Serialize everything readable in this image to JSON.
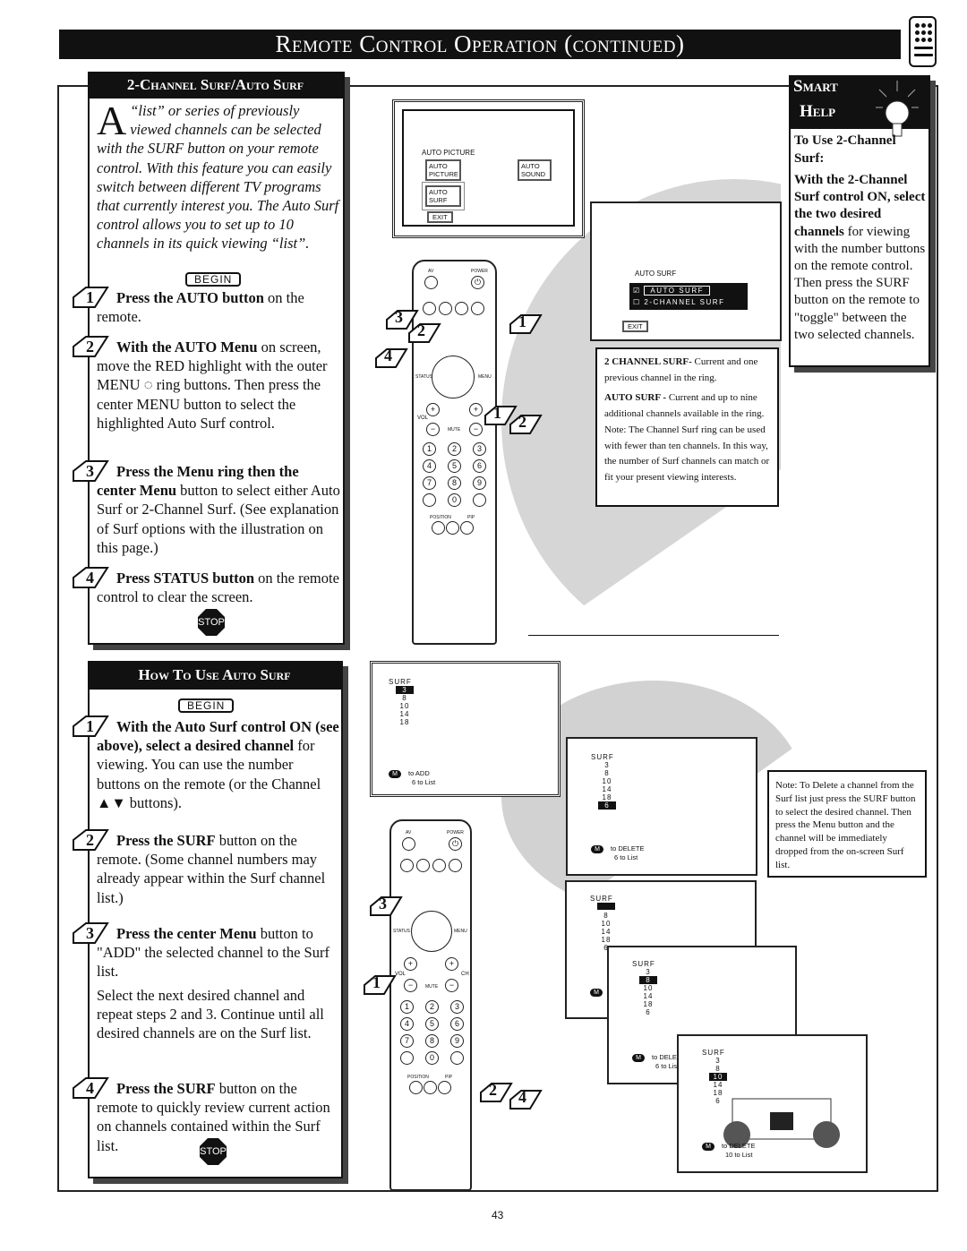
{
  "header": {
    "title": "Remote Control Operation (continued)",
    "icon": "remote-control-icon"
  },
  "section1": {
    "title": "2-Channel Surf/Auto Surf",
    "intro_drop_cap": "A",
    "intro": "“list” or series of previously viewed channels can be selected with the SURF button on your remote control. With this feature you can easily switch between different TV programs that currently interest you. The Auto Surf control allows you to set up to 10 channels in its quick viewing “list”.",
    "begin": "BEGIN",
    "steps": [
      {
        "num": "1",
        "bold": "Press the AUTO button",
        "text": " on the remote."
      },
      {
        "num": "2",
        "bold": "With the AUTO Menu",
        "text": " on screen,  move the RED highlight with the outer MENU ◌ ring buttons. Then press the center MENU button to select the highlighted Auto Surf control."
      },
      {
        "num": "3",
        "bold": "Press the Menu ring then the center Menu",
        "text": " button to select either Auto Surf or 2-Channel Surf. (See explanation of Surf options with the illustration on this page.)"
      },
      {
        "num": "4",
        "bold": "Press STATUS button",
        "text": " on the remote control to clear the screen."
      }
    ],
    "stop": "STOP"
  },
  "section2": {
    "title": "How To Use Auto Surf",
    "begin": "BEGIN",
    "steps": [
      {
        "num": "1",
        "bold": "With the Auto Surf control ON (see above), select a desired channel",
        "text": " for viewing. You can use the number buttons on the remote (or the Channel ▲▼ buttons)."
      },
      {
        "num": "2",
        "bold": "Press the SURF",
        "text": " button on the remote. (Some channel numbers may already appear within the Surf channel list.)"
      },
      {
        "num": "3",
        "bold": "Press the center Menu",
        "text": " button to \"ADD\" the selected channel to the Surf list."
      },
      {
        "num": "",
        "bold": "",
        "text": "Select the next desired channel and repeat steps 2 and 3. Continue until all desired channels are on the Surf list."
      },
      {
        "num": "4",
        "bold": "Press the SURF",
        "text": " button on the remote to quickly review current action on channels contained within the Surf list."
      }
    ],
    "stop": "STOP"
  },
  "auto_menu": {
    "heading": "AUTO PICTURE",
    "items": [
      "AUTO PICTURE",
      "AUTO SOUND",
      "AUTO SURF",
      "EXIT"
    ]
  },
  "auto_surf_menu": {
    "heading": "AUTO SURF",
    "options": [
      {
        "label": "AUTO SURF",
        "checked": true
      },
      {
        "label": "2-CHANNEL SURF",
        "checked": false
      }
    ],
    "exit": "EXIT"
  },
  "explain": {
    "p1_bold": "2 CHANNEL SURF-",
    "p1": " Current and one previous channel in the ring.",
    "p2_bold": "AUTO SURF -",
    "p2": " Current and up to nine additional channels available in the ring. Note: The Channel Surf ring can be used with fewer than ten channels. In this way, the number of Surf channels can match or fit your present viewing interests."
  },
  "smart_help": {
    "title1": "Smart",
    "title2": "Help",
    "subtitle": "To Use 2-Channel Surf:",
    "bold": "With the 2-Channel Surf control ON, select the two desired channels",
    "text": " for viewing with the number buttons on the remote control. Then press the SURF button on the remote to \"toggle\" between the two selected channels."
  },
  "note": "Note: To Delete a channel from the Surf list just press the SURF button to select the desired channel. Then press the Menu button and the channel will be immediately dropped from the on-screen Surf list.",
  "surf_screens": [
    {
      "label": "SURF",
      "list": [
        "3",
        "8",
        "10",
        "14",
        "18"
      ],
      "highlight": 0,
      "action": "to ADD",
      "count": "6 to List"
    },
    {
      "label": "SURF",
      "list": [
        "3",
        "8",
        "10",
        "14",
        "18",
        "6"
      ],
      "highlight": 5,
      "action": "to DELETE",
      "count": "6 to List"
    },
    {
      "label": "SURF",
      "list": [
        "",
        "8",
        "10",
        "14",
        "18",
        "6"
      ],
      "highlight": 0,
      "action": "",
      "count": ""
    },
    {
      "label": "SURF",
      "list": [
        "3",
        "8",
        "10",
        "14",
        "18",
        "6"
      ],
      "highlight": 1,
      "action": "to DELETE",
      "count": "6 to List"
    },
    {
      "label": "SURF",
      "list": [
        "3",
        "8",
        "10",
        "14",
        "18",
        "6"
      ],
      "highlight": 2,
      "action": "to DELETE",
      "count": "10 to List"
    }
  ],
  "m_button": "M",
  "remote_labels": {
    "av": "AV",
    "power": "POWER",
    "vol": "VOL",
    "ch": "CH",
    "mute": "MUTE",
    "position": "POSITION",
    "pip": "PIP",
    "status": "STATUS",
    "menu": "MENU",
    "digits": [
      "1",
      "2",
      "3",
      "4",
      "5",
      "6",
      "7",
      "8",
      "9",
      "0"
    ]
  },
  "callouts_top": [
    "3",
    "2",
    "4",
    "1",
    "1",
    "2"
  ],
  "callouts_bottom": [
    "3",
    "1",
    "2",
    "4"
  ],
  "page_number": "43"
}
